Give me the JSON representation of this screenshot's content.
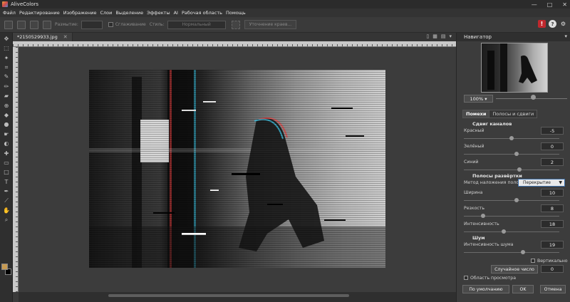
{
  "app": {
    "title": "AliveColors",
    "window_controls": [
      "—",
      "□",
      "✕"
    ]
  },
  "menu": [
    "Файл",
    "Редактирование",
    "Изображение",
    "Слои",
    "Выделение",
    "Эффекты",
    "AI",
    "Рабочая область",
    "Помощь"
  ],
  "toolbar": {
    "size_label": "Размытие:",
    "smoothing_label": "Сглаживание",
    "style_label": "Стиль:",
    "style_value": "Нормальный",
    "refine_button": "Уточнение краев..."
  },
  "document": {
    "tab_title": "*2150529933.jpg",
    "close": "✕"
  },
  "navigator": {
    "title": "Навигатор",
    "zoom": "100%"
  },
  "effect": {
    "tabs": [
      "Помехи",
      "Полосы и сдвиги"
    ],
    "channel_shift": {
      "title": "Сдвиг каналов",
      "red": {
        "label": "Красный",
        "value": "-5",
        "level": 0.5
      },
      "green": {
        "label": "Зелёный",
        "value": "0",
        "level": 0.55
      },
      "blue": {
        "label": "Синий",
        "value": "2",
        "level": 0.58
      }
    },
    "scan_lines": {
      "title": "Полосы развёртки",
      "blend_label": "Метод наложения полос",
      "blend_value": "Перекрытие",
      "width": {
        "label": "Ширина",
        "value": "10",
        "level": 0.55
      },
      "sharpness": {
        "label": "Резкость",
        "value": "8",
        "level": 0.2
      },
      "intensity": {
        "label": "Интенсивность",
        "value": "18",
        "level": 0.42
      }
    },
    "noise": {
      "title": "Шум",
      "intensity": {
        "label": "Интенсивность шума",
        "value": "19",
        "level": 0.62
      },
      "vertical_label": "Вертикально",
      "random_button": "Случайное число",
      "random_value": "0"
    },
    "preview_label": "Область просмотра",
    "default_button": "По умолчанию",
    "ok_button": "OK",
    "cancel_button": "Отмена"
  },
  "colors": {
    "accent": "#3d6fa8",
    "fg_color": "#c79a52",
    "bg_color": "#000000",
    "alert": "#c0282d"
  }
}
